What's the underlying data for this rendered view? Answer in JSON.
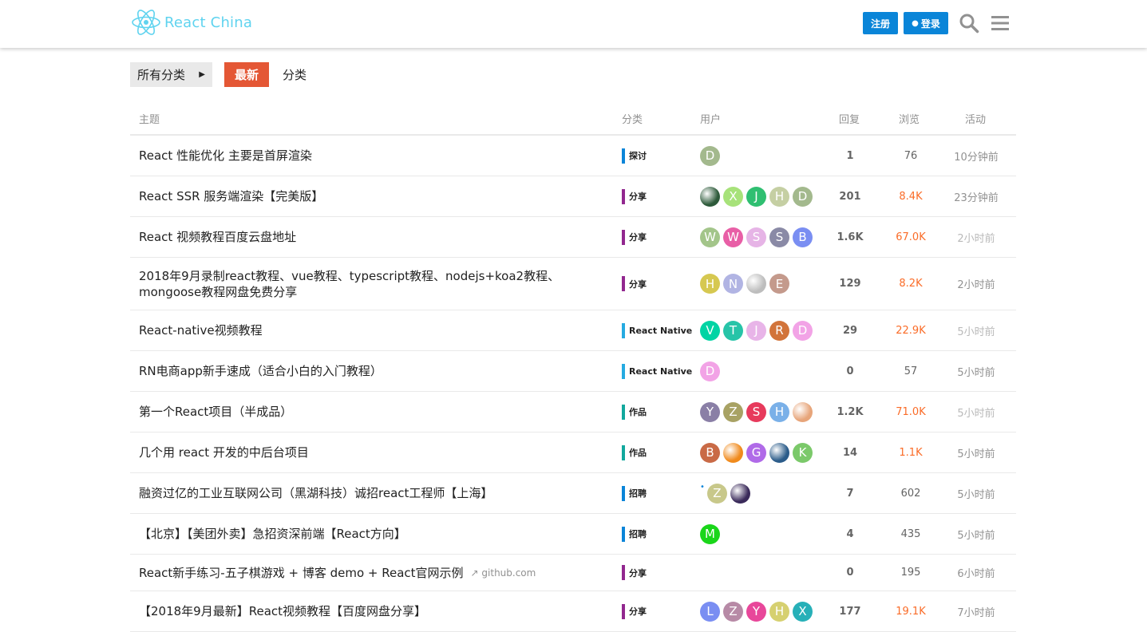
{
  "header": {
    "logo_text": "React China",
    "register_label": "注册",
    "login_label": "登录",
    "brand_color": "#0a85d8"
  },
  "nav": {
    "all_categories": "所有分类",
    "latest": "最新",
    "categories": "分类"
  },
  "table": {
    "headers": {
      "topic": "主题",
      "category": "分类",
      "users": "用户",
      "replies": "回复",
      "views": "浏览",
      "activity": "活动"
    },
    "rows": [
      {
        "title": "React 性能优化 主要是首屏渲染",
        "category": "探讨",
        "cat_color": "#0a85d8",
        "avatars": [
          {
            "letter": "D",
            "color": "#a3b98d"
          }
        ],
        "replies": "1",
        "views": "76",
        "views_hot": false,
        "activity": "10分钟前",
        "activity_dim": false
      },
      {
        "title": "React SSR 服务端渲染【完美版】",
        "category": "分享",
        "cat_color": "#92278f",
        "avatars": [
          {
            "letter": "",
            "color": "#2d5a3a",
            "img": true
          },
          {
            "letter": "X",
            "color": "#a7e27a"
          },
          {
            "letter": "J",
            "color": "#2fbf71"
          },
          {
            "letter": "H",
            "color": "#c5cfa3"
          },
          {
            "letter": "D",
            "color": "#a3b98d"
          }
        ],
        "replies": "201",
        "views": "8.4K",
        "views_hot": true,
        "activity": "23分钟前",
        "activity_dim": false
      },
      {
        "title": "React 视频教程百度云盘地址",
        "category": "分享",
        "cat_color": "#92278f",
        "avatars": [
          {
            "letter": "W",
            "color": "#a3c58a"
          },
          {
            "letter": "W",
            "color": "#e85fa6"
          },
          {
            "letter": "S",
            "color": "#e6b4e6"
          },
          {
            "letter": "S",
            "color": "#8a8aa6"
          },
          {
            "letter": "B",
            "color": "#7a8ef2"
          }
        ],
        "replies": "1.6K",
        "views": "67.0K",
        "views_hot": true,
        "activity": "2小时前",
        "activity_dim": true
      },
      {
        "title": "2018年9月录制react教程、vue教程、typescript教程、nodejs+koa2教程、mongoose教程网盘免费分享",
        "category": "分享",
        "cat_color": "#92278f",
        "avatars": [
          {
            "letter": "H",
            "color": "#d6c851"
          },
          {
            "letter": "N",
            "color": "#b1b4e3"
          },
          {
            "letter": "",
            "color": "#bdbdbd",
            "img": true
          },
          {
            "letter": "E",
            "color": "#c49a8c"
          }
        ],
        "replies": "129",
        "views": "8.2K",
        "views_hot": true,
        "activity": "2小时前",
        "activity_dim": false
      },
      {
        "title": "React-native视频教程",
        "category": "React Native",
        "cat_color": "#25aae1",
        "avatars": [
          {
            "letter": "V",
            "color": "#00d4a4"
          },
          {
            "letter": "T",
            "color": "#27c4a8"
          },
          {
            "letter": "J",
            "color": "#e8b4e8"
          },
          {
            "letter": "R",
            "color": "#d2743a"
          },
          {
            "letter": "D",
            "color": "#f2a3e6"
          }
        ],
        "replies": "29",
        "views": "22.9K",
        "views_hot": true,
        "activity": "5小时前",
        "activity_dim": true
      },
      {
        "title": "RN电商app新手速成（适合小白的入门教程）",
        "category": "React Native",
        "cat_color": "#25aae1",
        "avatars": [
          {
            "letter": "D",
            "color": "#f2a3e6"
          }
        ],
        "replies": "0",
        "views": "57",
        "views_hot": false,
        "activity": "5小时前",
        "activity_dim": false
      },
      {
        "title": "第一个React项目（半成品）",
        "category": "作品",
        "cat_color": "#12a89d",
        "avatars": [
          {
            "letter": "Y",
            "color": "#8a7fa6"
          },
          {
            "letter": "Z",
            "color": "#a8a264"
          },
          {
            "letter": "S",
            "color": "#e73a5c"
          },
          {
            "letter": "H",
            "color": "#7ab0e8"
          },
          {
            "letter": "",
            "color": "#e7a57a",
            "img": true
          }
        ],
        "replies": "1.2K",
        "views": "71.0K",
        "views_hot": true,
        "activity": "5小时前",
        "activity_dim": true
      },
      {
        "title": "几个用 react 开发的中后台项目",
        "category": "作品",
        "cat_color": "#12a89d",
        "avatars": [
          {
            "letter": "B",
            "color": "#c96a46"
          },
          {
            "letter": "",
            "color": "#f08a1c",
            "img": true
          },
          {
            "letter": "G",
            "color": "#b06ae8"
          },
          {
            "letter": "",
            "color": "#2b5c8a",
            "img": true
          },
          {
            "letter": "K",
            "color": "#7bc96a"
          }
        ],
        "replies": "14",
        "views": "1.1K",
        "views_hot": true,
        "activity": "5小时前",
        "activity_dim": false
      },
      {
        "title": "融资过亿的工业互联网公司（黑湖科技）诚招react工程师【上海】",
        "category": "招聘",
        "cat_color": "#0a85d8",
        "avatars": [
          {
            "letter": "Z",
            "color": "#c8c88a",
            "dot": true
          },
          {
            "letter": "",
            "color": "#3a2a5a",
            "img": true
          }
        ],
        "replies": "7",
        "views": "602",
        "views_hot": false,
        "activity": "5小时前",
        "activity_dim": false
      },
      {
        "title": "【北京】【美团外卖】急招资深前端【React方向】",
        "category": "招聘",
        "cat_color": "#0a85d8",
        "avatars": [
          {
            "letter": "M",
            "color": "#1ad61a"
          }
        ],
        "replies": "4",
        "views": "435",
        "views_hot": false,
        "activity": "5小时前",
        "activity_dim": false
      },
      {
        "title": "React新手练习-五子棋游戏 + 博客 demo + React官网示例",
        "link_host": "github.com",
        "category": "分享",
        "cat_color": "#92278f",
        "avatars": [],
        "replies": "0",
        "views": "195",
        "views_hot": false,
        "activity": "6小时前",
        "activity_dim": false
      },
      {
        "title": "【2018年9月最新】React视频教程【百度网盘分享】",
        "category": "分享",
        "cat_color": "#92278f",
        "avatars": [
          {
            "letter": "L",
            "color": "#7a8ef2"
          },
          {
            "letter": "Z",
            "color": "#b78aa6"
          },
          {
            "letter": "Y",
            "color": "#e8479a"
          },
          {
            "letter": "H",
            "color": "#d6d070"
          },
          {
            "letter": "X",
            "color": "#27b0b8"
          }
        ],
        "replies": "177",
        "views": "19.1K",
        "views_hot": true,
        "activity": "7小时前",
        "activity_dim": false
      }
    ]
  }
}
